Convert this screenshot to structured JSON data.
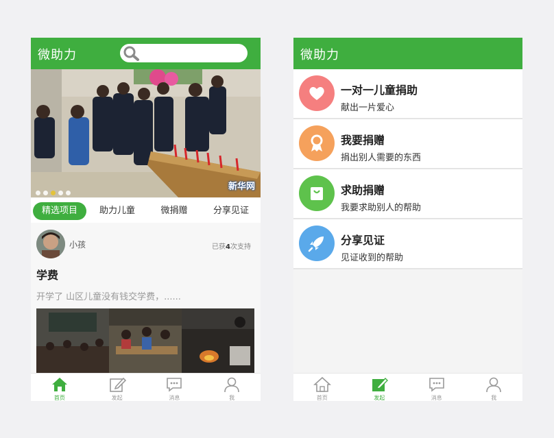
{
  "left_screen": {
    "header": {
      "title": "微助力",
      "search_placeholder": ""
    },
    "banner": {
      "watermark": "新华网",
      "dots": [
        false,
        false,
        true,
        false,
        false
      ]
    },
    "tabs": [
      {
        "label": "精选项目",
        "active": true
      },
      {
        "label": "助力儿童",
        "active": false
      },
      {
        "label": "微捐赠",
        "active": false
      },
      {
        "label": "分享见证",
        "active": false
      }
    ],
    "post": {
      "username": "小孩",
      "support_prefix": "已获",
      "support_count": "4",
      "support_suffix": "次支持",
      "title": "学费",
      "description": "开学了 山区儿童没有钱交学费，......"
    },
    "tabbar": [
      {
        "label": "首页",
        "icon": "home-icon",
        "selected": true
      },
      {
        "label": "发起",
        "icon": "edit-icon",
        "selected": false
      },
      {
        "label": "消息",
        "icon": "message-icon",
        "selected": false
      },
      {
        "label": "我",
        "icon": "person-icon",
        "selected": false
      }
    ]
  },
  "right_screen": {
    "header": {
      "title": "微助力"
    },
    "items": [
      {
        "title": "一对一儿童捐助",
        "subtitle": "献出一片爱心",
        "icon": "heart-icon",
        "color": "#f57f7f"
      },
      {
        "title": "我要捐赠",
        "subtitle": "捐出别人需要的东西",
        "icon": "award-icon",
        "color": "#f5a15c"
      },
      {
        "title": "求助捐赠",
        "subtitle": "我要求助别人的帮助",
        "icon": "bag-icon",
        "color": "#5ec24c"
      },
      {
        "title": "分享见证",
        "subtitle": "见证收到的帮助",
        "icon": "rocket-icon",
        "color": "#5aa9ea"
      }
    ],
    "tabbar": [
      {
        "label": "首页",
        "icon": "home-icon",
        "selected": false
      },
      {
        "label": "发起",
        "icon": "edit-icon",
        "selected": true
      },
      {
        "label": "消息",
        "icon": "message-icon",
        "selected": false
      },
      {
        "label": "我",
        "icon": "person-icon",
        "selected": false
      }
    ]
  },
  "colors": {
    "brand_green": "#3fae3f",
    "background": "#f1f1f3"
  }
}
